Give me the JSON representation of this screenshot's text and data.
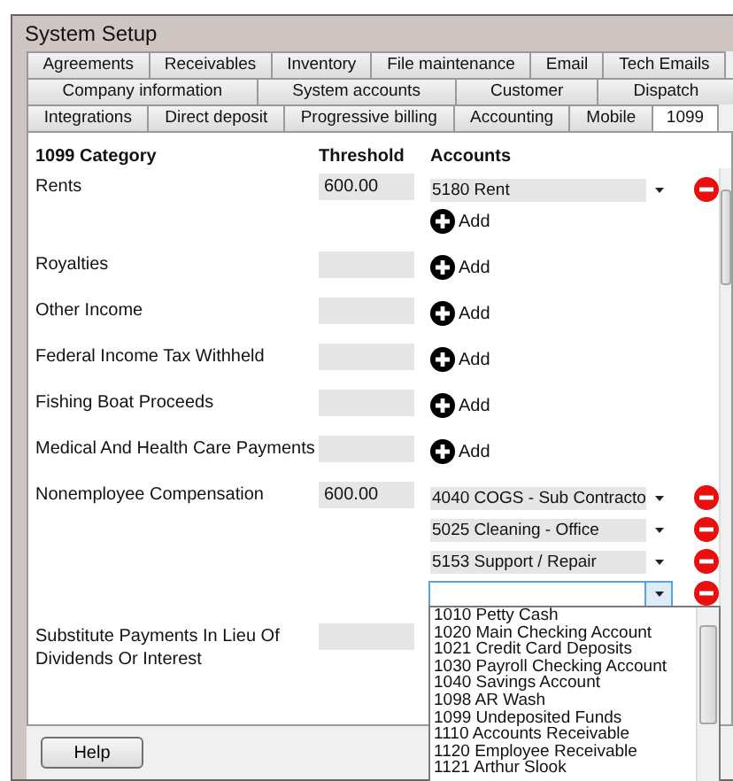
{
  "window": {
    "title": "System Setup"
  },
  "tab_rows": [
    [
      {
        "label": "Agreements",
        "selected": false
      },
      {
        "label": "Receivables",
        "selected": false
      },
      {
        "label": "Inventory",
        "selected": false
      },
      {
        "label": "File maintenance",
        "selected": false
      },
      {
        "label": "Email",
        "selected": false
      },
      {
        "label": "Tech Emails",
        "selected": false
      }
    ],
    [
      {
        "label": "Company information",
        "selected": false
      },
      {
        "label": "System accounts",
        "selected": false
      },
      {
        "label": "Customer",
        "selected": false
      },
      {
        "label": "Dispatch",
        "selected": false
      }
    ],
    [
      {
        "label": "Integrations",
        "selected": false
      },
      {
        "label": "Direct deposit",
        "selected": false
      },
      {
        "label": "Progressive billing",
        "selected": false
      },
      {
        "label": "Accounting",
        "selected": false
      },
      {
        "label": "Mobile",
        "selected": false
      },
      {
        "label": "1099",
        "selected": true
      }
    ]
  ],
  "table": {
    "columns": [
      "1099 Category",
      "Threshold",
      "Accounts"
    ],
    "rows": [
      {
        "category": "Rents",
        "threshold": "600.00",
        "accounts": [
          {
            "value": "5180 Rent",
            "focused": false
          }
        ],
        "add": "Add"
      },
      {
        "category": "Royalties",
        "accounts": [],
        "add": "Add"
      },
      {
        "category": "Other Income",
        "accounts": [],
        "add": "Add"
      },
      {
        "category": "Federal Income Tax Withheld",
        "accounts": [],
        "add": "Add"
      },
      {
        "category": "Fishing Boat Proceeds",
        "accounts": [],
        "add": "Add"
      },
      {
        "category": "Medical And Health Care Payments",
        "accounts": [],
        "add": "Add"
      },
      {
        "category": "Nonemployee Compensation",
        "threshold": "600.00",
        "accounts": [
          {
            "value": "4040 COGS - Sub Contracto",
            "focused": false
          },
          {
            "value": "5025 Cleaning - Office",
            "focused": false
          },
          {
            "value": "5153 Support / Repair",
            "focused": false
          },
          {
            "focused": true,
            "open": true
          }
        ]
      },
      {
        "category": "Substitute Payments In Lieu Of Dividends Or Interest",
        "accounts": []
      }
    ]
  },
  "dropdown": {
    "options": [
      "1010 Petty Cash",
      "1020 Main Checking Account",
      "1021 Credit Card Deposits",
      "1030 Payroll Checking Account",
      "1040 Savings Account",
      "1098 AR Wash",
      "1099 Undeposited Funds",
      "1110 Accounts Receivable",
      "1120 Employee Receivable",
      "1121 Arthur Slook"
    ]
  },
  "buttons": [
    {
      "label": "Help"
    }
  ]
}
